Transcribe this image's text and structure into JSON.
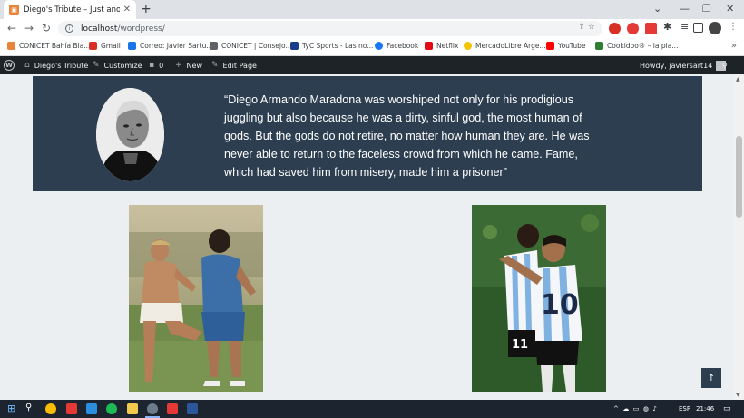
{
  "browser": {
    "tab_title": "Diego's Tribute – Just another W",
    "url_host": "localhost",
    "url_path": "/wordpress/",
    "bookmarks": [
      {
        "label": "CONICET Bahía Bla...",
        "color": "#e8833a"
      },
      {
        "label": "Gmail",
        "color": "#d93025"
      },
      {
        "label": "Correo: Javier Sartu...",
        "color": "#1a73e8"
      },
      {
        "label": "CONICET | Consejo...",
        "color": "#5f6368"
      },
      {
        "label": "TyC Sports - Las no...",
        "color": "#1a3c8a"
      },
      {
        "label": "Facebook",
        "color": "#1877f2"
      },
      {
        "label": "Netflix",
        "color": "#e50914"
      },
      {
        "label": "MercadoLibre Arge...",
        "color": "#f5c400"
      },
      {
        "label": "YouTube",
        "color": "#ff0000"
      },
      {
        "label": "Cookidoo® – la pla...",
        "color": "#2e7d32"
      }
    ]
  },
  "adminbar": {
    "site_name": "Diego's Tribute",
    "customize": "Customize",
    "comments_count": "0",
    "new": "New",
    "edit_page": "Edit Page",
    "howdy": "Howdy, javiersart14"
  },
  "quote": {
    "text": "“Diego Armando Maradona was worshiped not only for his prodigious juggling but also because he was a dirty, sinful god, the most human of gods. But the gods do not retire, no matter how human they are. He was never able to return to the faceless crowd from which he came. Fame, which had saved him from misery, made him a prisoner”"
  },
  "photo_right": {
    "jersey_number": "10",
    "second_number": "11"
  },
  "taskbar": {
    "lang": "ESP",
    "time": "21:46"
  },
  "colors": {
    "quote_bg": "#2c3e50",
    "page_bg": "#eceff1",
    "adminbar_bg": "#1d2327",
    "taskbar_bg": "#1c2430"
  }
}
